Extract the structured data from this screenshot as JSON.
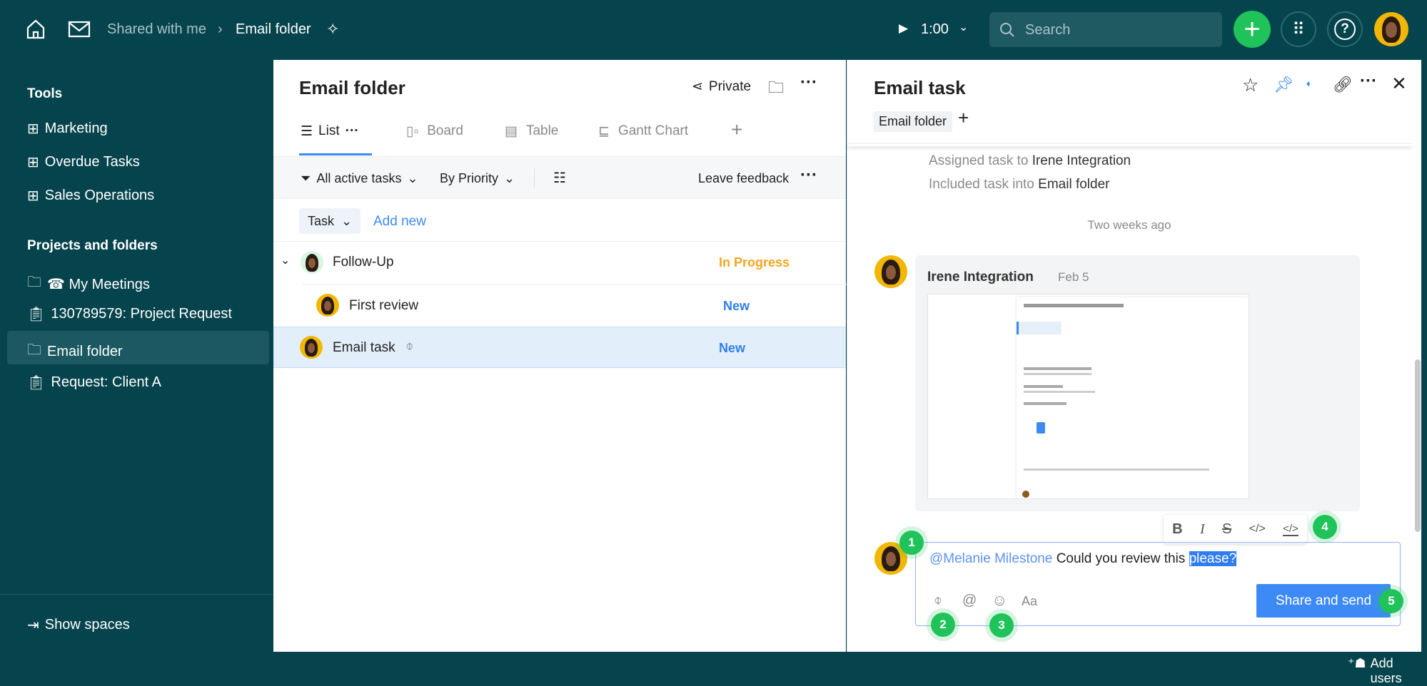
{
  "topbar": {
    "breadcrumb_parent": "Shared with me",
    "breadcrumb_current": "Email folder",
    "timer": "1:00",
    "search_placeholder": "Search"
  },
  "sidebar": {
    "tools_heading": "Tools",
    "tools": [
      {
        "label": "Marketing"
      },
      {
        "label": "Overdue Tasks"
      },
      {
        "label": "Sales Operations"
      }
    ],
    "projects_heading": "Projects and folders",
    "projects": [
      {
        "label": "☎ My Meetings",
        "icon": "folder-icon"
      },
      {
        "label": "130789579: Project Request",
        "icon": "clipboard-icon"
      },
      {
        "label": "Email folder",
        "icon": "folder-icon",
        "selected": true
      },
      {
        "label": "Request: Client A",
        "icon": "clipboard-icon"
      }
    ],
    "show_spaces": "Show spaces"
  },
  "folder": {
    "title": "Email folder",
    "privacy": "Private",
    "tabs": [
      {
        "label": "List",
        "active": true
      },
      {
        "label": "Board"
      },
      {
        "label": "Table"
      },
      {
        "label": "Gantt Chart"
      }
    ],
    "filter": "All active tasks",
    "sort": "By Priority",
    "feedback": "Leave feedback",
    "task_type": "Task",
    "add_new": "Add new",
    "tasks": [
      {
        "name": "Follow-Up",
        "status": "In Progress",
        "status_color": "#f5a623"
      },
      {
        "name": "First review",
        "status": "New",
        "status_color": "#2f80ed"
      },
      {
        "name": "Email task",
        "status": "New",
        "status_color": "#2f80ed",
        "selected": true
      }
    ]
  },
  "task": {
    "title": "Email task",
    "tag": "Email folder",
    "activity": [
      {
        "prefix": "Assigned task to ",
        "target": "Irene Integration"
      },
      {
        "prefix": "Included task into ",
        "target": "Email folder"
      }
    ],
    "date_sep": "Two weeks ago",
    "comment": {
      "author": "Irene Integration",
      "date": "Feb 5"
    },
    "composer": {
      "mention": "@Melanie Milestone",
      "text": " Could you review this ",
      "selected": "please?",
      "send": "Share and send",
      "font_label": "Aa"
    },
    "format": {
      "bold": "B",
      "italic": "I",
      "strike": "S"
    },
    "badges": [
      "1",
      "2",
      "3",
      "4",
      "5"
    ]
  },
  "footer": {
    "add_users": "Add users"
  },
  "colors": {
    "topbar": "#06444d",
    "accent": "#3d8af7",
    "badge": "#1fc35a",
    "selected_row": "#e3eefb"
  }
}
